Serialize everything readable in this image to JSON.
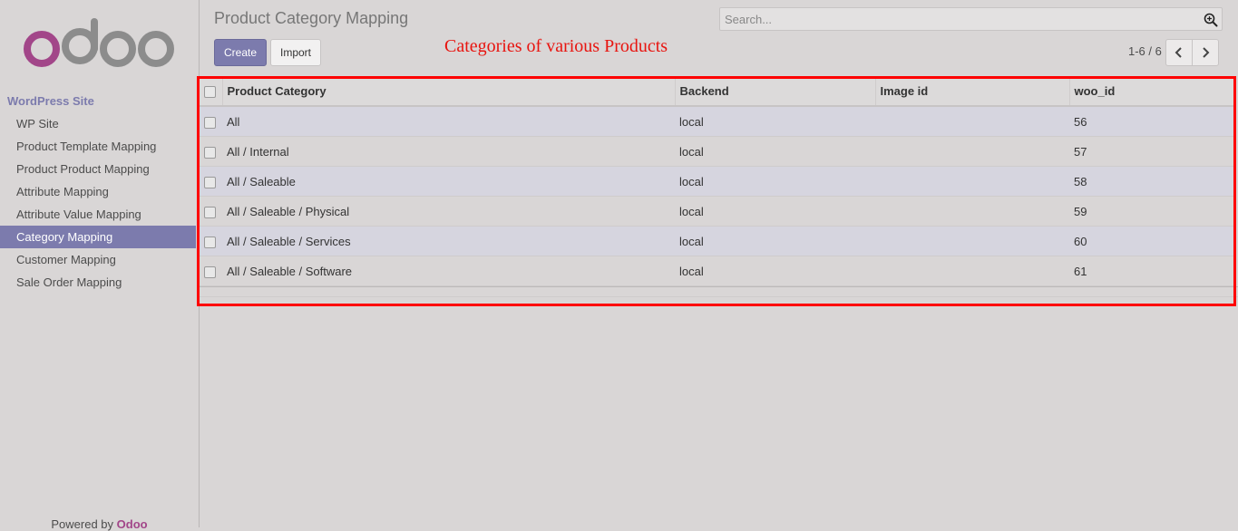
{
  "sidebar": {
    "heading": "WordPress Site",
    "items": [
      {
        "label": "WP Site",
        "active": false
      },
      {
        "label": "Product Template Mapping",
        "active": false
      },
      {
        "label": "Product Product Mapping",
        "active": false
      },
      {
        "label": "Attribute Mapping",
        "active": false
      },
      {
        "label": "Attribute Value Mapping",
        "active": false
      },
      {
        "label": "Category Mapping",
        "active": true
      },
      {
        "label": "Customer Mapping",
        "active": false
      },
      {
        "label": "Sale Order Mapping",
        "active": false
      }
    ],
    "powered_prefix": "Powered by",
    "powered_brand": "Odoo"
  },
  "header": {
    "title": "Product Category Mapping",
    "search_placeholder": "Search...",
    "create_label": "Create",
    "import_label": "Import",
    "annotation": "Categories of various Products",
    "pager": "1-6 / 6"
  },
  "table": {
    "columns": [
      "Product Category",
      "Backend",
      "Image id",
      "woo_id"
    ],
    "rows": [
      {
        "category": "All",
        "backend": "local",
        "image_id": "",
        "woo_id": "56"
      },
      {
        "category": "All / Internal",
        "backend": "local",
        "image_id": "",
        "woo_id": "57"
      },
      {
        "category": "All / Saleable",
        "backend": "local",
        "image_id": "",
        "woo_id": "58"
      },
      {
        "category": "All / Saleable / Physical",
        "backend": "local",
        "image_id": "",
        "woo_id": "59"
      },
      {
        "category": "All / Saleable / Services",
        "backend": "local",
        "image_id": "",
        "woo_id": "60"
      },
      {
        "category": "All / Saleable / Software",
        "backend": "local",
        "image_id": "",
        "woo_id": "61"
      }
    ]
  },
  "colors": {
    "accent": "#7c7bad",
    "brand_logo_o": "#a24689",
    "annotation_red": "#ff0000"
  },
  "icons": {
    "logo": "odoo-logo",
    "search": "search-icon",
    "prev": "chevron-left-icon",
    "next": "chevron-right-icon"
  }
}
